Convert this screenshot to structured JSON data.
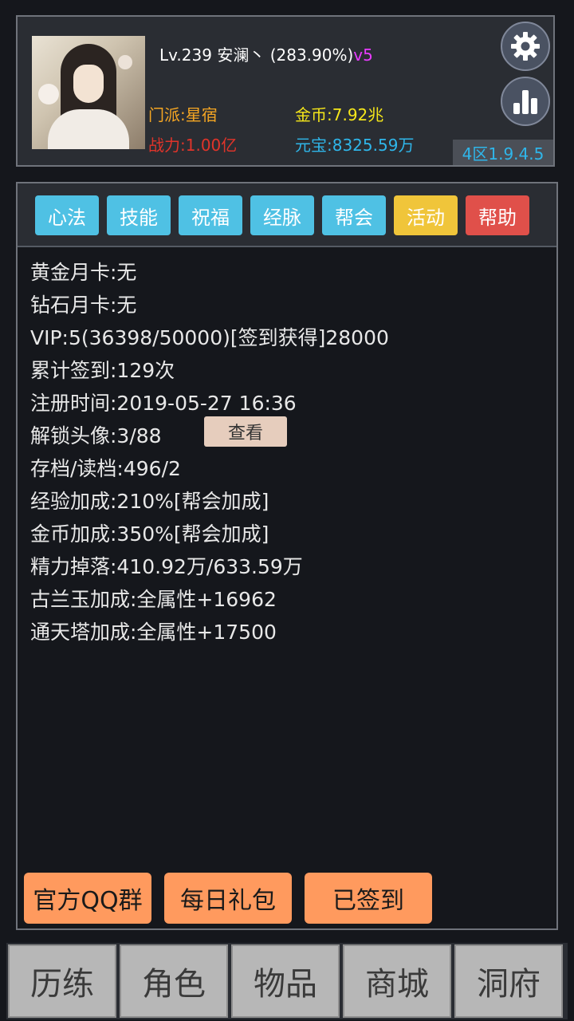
{
  "header": {
    "level": "Lv.239",
    "player_name": "安澜丶",
    "exp_percent": "(283.90%)",
    "vip_tag": "v5",
    "sect": "门派:星宿",
    "combat_power": "战力:1.00亿",
    "gold": "金币:7.92兆",
    "ingot": "元宝:8325.59万",
    "server_version": "4区1.9.4.5",
    "icons": {
      "settings": "gear-icon",
      "stats": "bar-chart-icon"
    }
  },
  "tabs": [
    {
      "label": "心法",
      "color": "#4fc1e4"
    },
    {
      "label": "技能",
      "color": "#4fc1e4"
    },
    {
      "label": "祝福",
      "color": "#4fc1e4"
    },
    {
      "label": "经脉",
      "color": "#4fc1e4"
    },
    {
      "label": "帮会",
      "color": "#4fc1e4"
    },
    {
      "label": "活动",
      "color": "#f0c53a"
    },
    {
      "label": "帮助",
      "color": "#e0504a"
    }
  ],
  "info": {
    "gold_monthly_card": "黄金月卡:无",
    "diamond_monthly_card": "钻石月卡:无",
    "vip_progress": "VIP:5(36398/50000)[签到获得]28000",
    "total_checkins": "累计签到:129次",
    "register_time": "注册时间:2019-05-27 16:36",
    "unlocked_avatars": "解锁头像:3/88",
    "view_button": "查看",
    "save_load": "存档/读档:496/2",
    "exp_bonus": "经验加成:210%[帮会加成]",
    "gold_bonus": "金币加成:350%[帮会加成]",
    "energy_drop": "精力掉落:410.92万/633.59万",
    "gulan_jade_bonus": "古兰玉加成:全属性+16962",
    "tongtian_tower_bonus": "通天塔加成:全属性+17500"
  },
  "actions": {
    "qq_group": "官方QQ群",
    "daily_gift": "每日礼包",
    "checked_in": "已签到"
  },
  "bottom_nav": [
    "历练",
    "角色",
    "物品",
    "商城",
    "洞府"
  ]
}
